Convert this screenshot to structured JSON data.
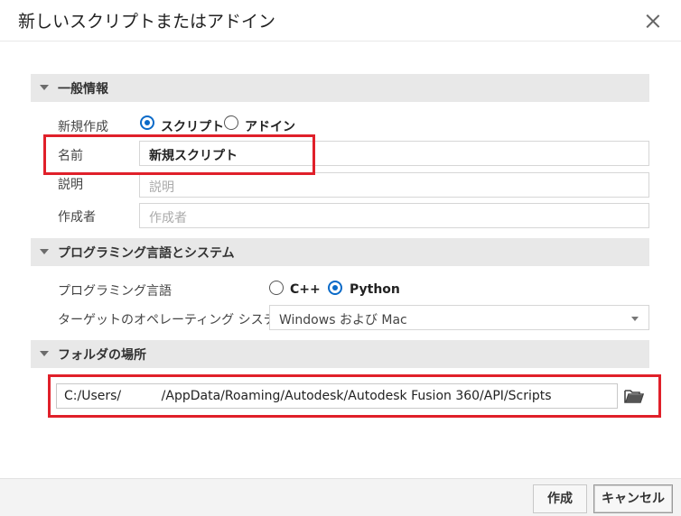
{
  "dialog": {
    "title": "新しいスクリプトまたはアドイン"
  },
  "general": {
    "section_title": "一般情報",
    "create_label": "新規作成",
    "create_options": [
      {
        "label": "スクリプト",
        "checked": true
      },
      {
        "label": "アドイン",
        "checked": false
      }
    ],
    "name_label": "名前",
    "name_value": "新規スクリプト",
    "description_label": "説明",
    "description_placeholder": "説明",
    "author_label": "作成者",
    "author_placeholder": "作成者"
  },
  "language": {
    "section_title": "プログラミング言語とシステム",
    "language_label": "プログラミング言語",
    "language_options": [
      {
        "label": "C++",
        "checked": false
      },
      {
        "label": "Python",
        "checked": true
      }
    ],
    "os_label": "ターゲットのオペレーティング システム",
    "os_value": "Windows および Mac"
  },
  "folder": {
    "section_title": "フォルダの場所",
    "path_value": "C:/Users/     /AppData/Roaming/Autodesk/Autodesk Fusion 360/API/Scripts"
  },
  "footer": {
    "create_button": "作成",
    "cancel_button": "キャンセル"
  },
  "colors": {
    "accent": "#0a6ac8",
    "highlight_box": "#e0202a",
    "section_bg": "#e8e8e8"
  }
}
